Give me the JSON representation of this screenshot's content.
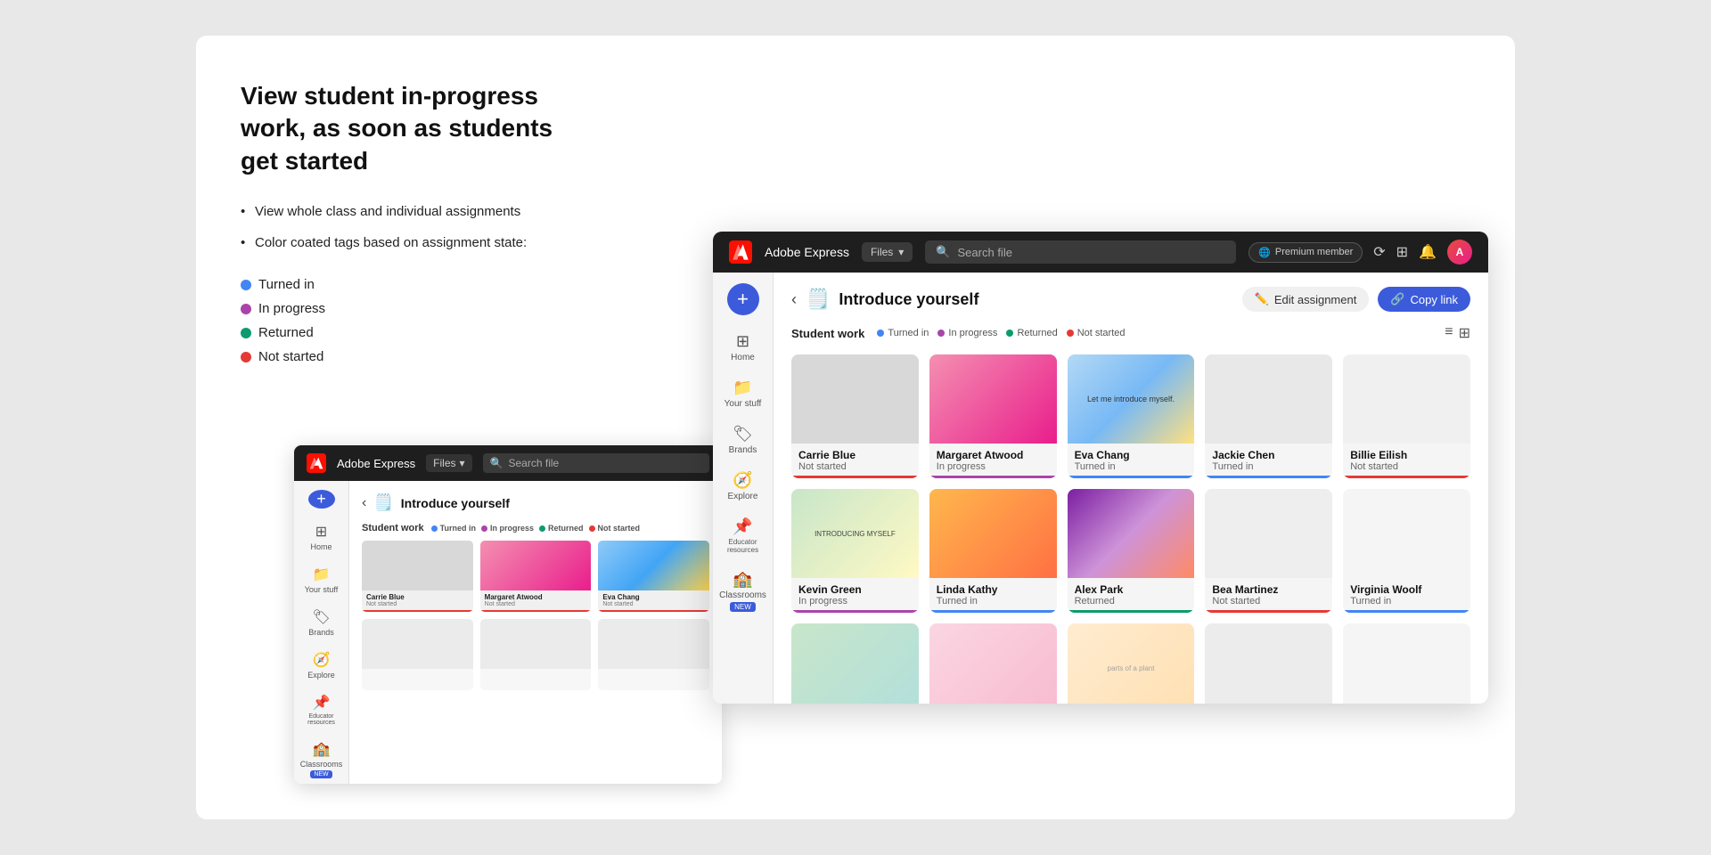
{
  "page": {
    "title": "View student in-progress work, as soon as students get started",
    "bullets": [
      "View whole class and individual assignments",
      "Color coated tags based on assignment state:"
    ],
    "tags": [
      {
        "label": "Turned in",
        "color": "blue"
      },
      {
        "label": "In progress",
        "color": "purple"
      },
      {
        "label": "Returned",
        "color": "green"
      },
      {
        "label": "Not started",
        "color": "red"
      }
    ]
  },
  "mini_window": {
    "topbar": {
      "app_name": "Adobe Express",
      "dropdown": "Files",
      "search_placeholder": "Search file"
    },
    "sidebar": {
      "items": [
        "Home",
        "Your stuff",
        "Brands",
        "Explore",
        "Educator resources",
        "Classrooms"
      ]
    },
    "assignment": {
      "title": "Introduce yourself",
      "icon": "🗒️"
    },
    "student_work": {
      "label": "Student work",
      "statuses": [
        "Turned in",
        "In progress",
        "Returned",
        "Not started"
      ]
    },
    "students": [
      {
        "name": "Carrie Blue",
        "status": "Not started",
        "bar_color": "#E53935"
      },
      {
        "name": "Margaret Atwood",
        "status": "Not started",
        "bar_color": "#E53935"
      },
      {
        "name": "Eva Chang",
        "status": "Not started",
        "bar_color": "#E53935"
      }
    ]
  },
  "main_window": {
    "topbar": {
      "app_name": "Adobe Express",
      "dropdown": "Files",
      "search_placeholder": "Search file",
      "premium_label": "Premium member"
    },
    "sidebar": {
      "items": [
        {
          "label": "Home",
          "icon": "⊞"
        },
        {
          "label": "Your stuff",
          "icon": "📁"
        },
        {
          "label": "Brands",
          "icon": "🏷"
        },
        {
          "label": "Explore",
          "icon": "🧭"
        },
        {
          "label": "Educator resources",
          "icon": "📌"
        },
        {
          "label": "Classrooms",
          "icon": "🏫"
        }
      ]
    },
    "assignment": {
      "title": "Introduce yourself",
      "icon": "🗒️",
      "edit_btn": "Edit assignment",
      "copy_btn": "Copy link"
    },
    "student_work": {
      "label": "Student work",
      "statuses": [
        {
          "label": "Turned in",
          "color": "#4285F4"
        },
        {
          "label": "In progress",
          "color": "#AA44AA"
        },
        {
          "label": "Returned",
          "color": "#0C9B6E"
        },
        {
          "label": "Not started",
          "color": "#E53935"
        }
      ]
    },
    "row1_students": [
      {
        "name": "Carrie Blue",
        "status": "Not started",
        "bar_color": "#E53935",
        "thumb": "gray"
      },
      {
        "name": "Margaret Atwood",
        "status": "In progress",
        "bar_color": "#AA44AA",
        "thumb": "pink"
      },
      {
        "name": "Eva Chang",
        "status": "Turned in",
        "bar_color": "#4285F4",
        "thumb": "blue-light"
      },
      {
        "name": "Jackie Chen",
        "status": "Turned in",
        "bar_color": "#4285F4",
        "thumb": "light-gray"
      },
      {
        "name": "Billie Eilish",
        "status": "Not started",
        "bar_color": "#E53935",
        "thumb": "very-light"
      }
    ],
    "row2_students": [
      {
        "name": "Kevin Green",
        "status": "In progress",
        "bar_color": "#AA44AA",
        "thumb": "green-tan"
      },
      {
        "name": "Linda Kathy",
        "status": "Turned in",
        "bar_color": "#4285F4",
        "thumb": "orange"
      },
      {
        "name": "Alex Park",
        "status": "Returned",
        "bar_color": "#0C9B6E",
        "thumb": "purple-dark"
      },
      {
        "name": "Bea Martinez",
        "status": "Not started",
        "bar_color": "#E53935",
        "thumb": "white-lines"
      },
      {
        "name": "Virginia Woolf",
        "status": "Turned in",
        "bar_color": "#4285F4",
        "thumb": "very-light"
      }
    ],
    "row3_students": [
      {
        "name": "",
        "status": "",
        "bar_color": "#eee",
        "thumb": "green2"
      },
      {
        "name": "",
        "status": "",
        "bar_color": "#eee",
        "thumb": "pink2"
      },
      {
        "name": "",
        "status": "",
        "bar_color": "#eee",
        "thumb": "warm"
      },
      {
        "name": "",
        "status": "",
        "bar_color": "#eee",
        "thumb": "light-gray"
      },
      {
        "name": "",
        "status": "",
        "bar_color": "#eee",
        "thumb": "very-light"
      }
    ]
  }
}
